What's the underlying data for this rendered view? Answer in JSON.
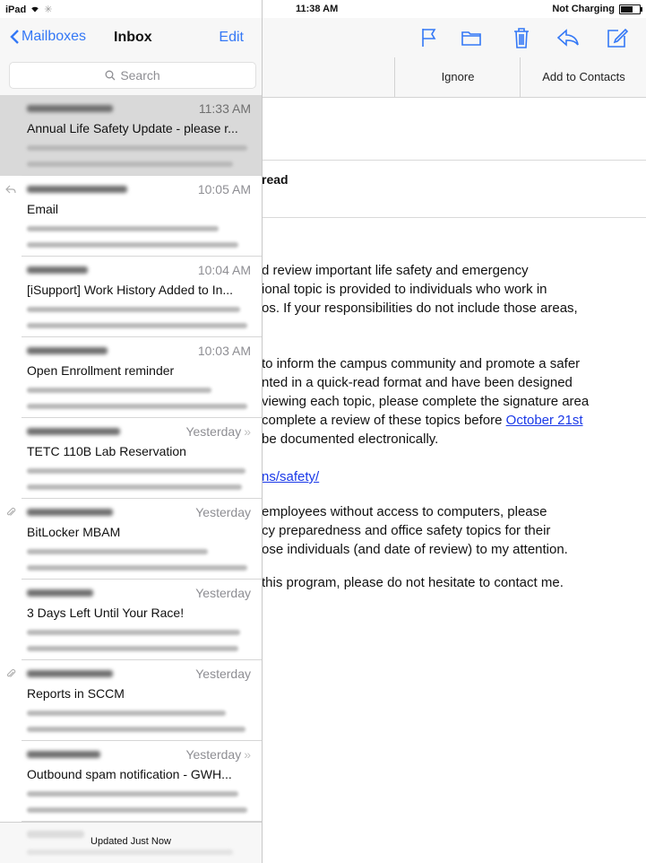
{
  "status_bar": {
    "device": "iPad",
    "time": "11:38 AM",
    "charging": "Not Charging"
  },
  "sidebar": {
    "back_label": "Mailboxes",
    "title": "Inbox",
    "edit_label": "Edit",
    "search_placeholder": "Search",
    "footer_status": "Updated Just Now",
    "messages": [
      {
        "time": "11:33 AM",
        "subject": "Annual Life Safety Update - please r...",
        "selected": true,
        "icon": "",
        "thread": false
      },
      {
        "time": "10:05 AM",
        "subject": "Email",
        "selected": false,
        "icon": "reply-arrow-icon",
        "thread": false
      },
      {
        "time": "10:04 AM",
        "subject": "[iSupport] Work History Added to In...",
        "selected": false,
        "icon": "",
        "thread": false
      },
      {
        "time": "10:03 AM",
        "subject": "Open Enrollment reminder",
        "selected": false,
        "icon": "",
        "thread": false
      },
      {
        "time": "Yesterday",
        "subject": "TETC 110B Lab Reservation",
        "selected": false,
        "icon": "",
        "thread": true
      },
      {
        "time": "Yesterday",
        "subject": "BitLocker MBAM",
        "selected": false,
        "icon": "paperclip-icon",
        "thread": false
      },
      {
        "time": "Yesterday",
        "subject": "3 Days Left Until Your Race!",
        "selected": false,
        "icon": "",
        "thread": false
      },
      {
        "time": "Yesterday",
        "subject": "Reports in SCCM",
        "selected": false,
        "icon": "paperclip-icon",
        "thread": false
      },
      {
        "time": "Yesterday",
        "subject": "Outbound spam notification - GWH...",
        "selected": false,
        "icon": "",
        "thread": true
      }
    ]
  },
  "toolbar": {
    "icons": [
      "flag-icon",
      "folder-icon",
      "trash-icon",
      "reply-icon",
      "compose-icon"
    ],
    "accent": "#3478f6"
  },
  "actionbar": {
    "ignore_label": "Ignore",
    "add_contacts_label": "Add to Contacts"
  },
  "message": {
    "subject_fragment": "read",
    "lines": [
      "d review important life safety and emergency",
      "ional topic is provided to individuals who work in",
      "os.  If your responsibilities do not include those areas,",
      "to inform the campus community and promote a safer",
      "nted in a quick-read format and have been designed",
      "viewing each topic, please complete the signature area",
      "complete a review of these topics before ",
      "be documented electronically.",
      "ns/safety/",
      "employees without access to computers, please",
      "cy preparedness and office safety topics for their",
      "ose individuals (and date of review) to my attention.",
      "this program, please do not hesitate to contact me."
    ],
    "deadline_link": "October 21st",
    "link_color": "#1a39e8"
  }
}
